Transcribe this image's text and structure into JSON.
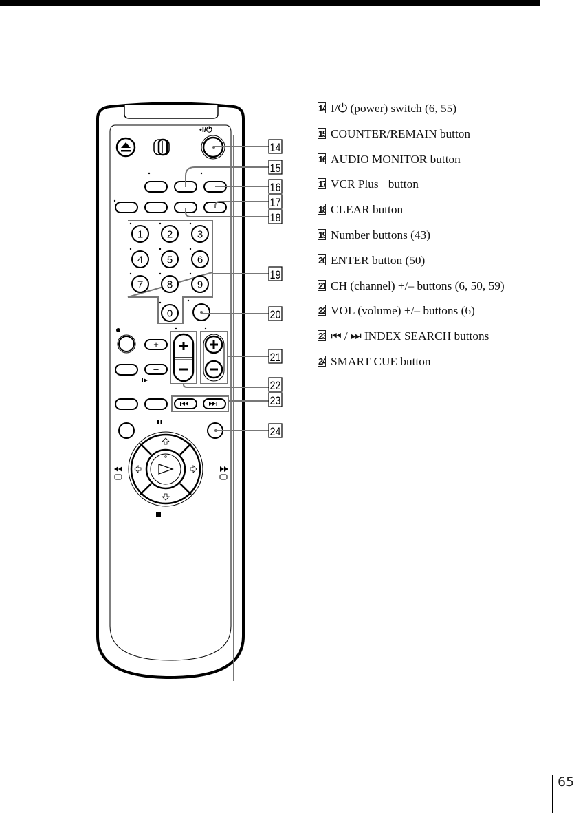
{
  "page": {
    "number": "65"
  },
  "diagram": {
    "power_label": "•I/⏻",
    "number_keys": [
      "1",
      "2",
      "3",
      "4",
      "5",
      "6",
      "7",
      "8",
      "9",
      "0"
    ],
    "callouts": [
      "14",
      "15",
      "16",
      "17",
      "18",
      "19",
      "20",
      "21",
      "22",
      "23",
      "24"
    ],
    "plus": "+",
    "minus": "–",
    "index_prev": "I◀◀",
    "index_next": "▶▶I"
  },
  "legend": {
    "items": [
      {
        "num": "14",
        "text": "I/⏻ (power) switch (6, 55)"
      },
      {
        "num": "15",
        "text": "COUNTER/REMAIN button"
      },
      {
        "num": "16",
        "text": "AUDIO MONITOR button"
      },
      {
        "num": "17",
        "text": "VCR Plus+ button"
      },
      {
        "num": "18",
        "text": "CLEAR button"
      },
      {
        "num": "19",
        "text": "Number buttons (43)"
      },
      {
        "num": "20",
        "text": "ENTER button (50)"
      },
      {
        "num": "21",
        "text": "CH (channel) +/– buttons (6, 50, 59)"
      },
      {
        "num": "22",
        "text": "VOL (volume) +/– buttons (6)"
      },
      {
        "num": "23",
        "text": "⏮ / ⏭ INDEX SEARCH buttons"
      },
      {
        "num": "24",
        "text": "SMART CUE button"
      }
    ]
  }
}
